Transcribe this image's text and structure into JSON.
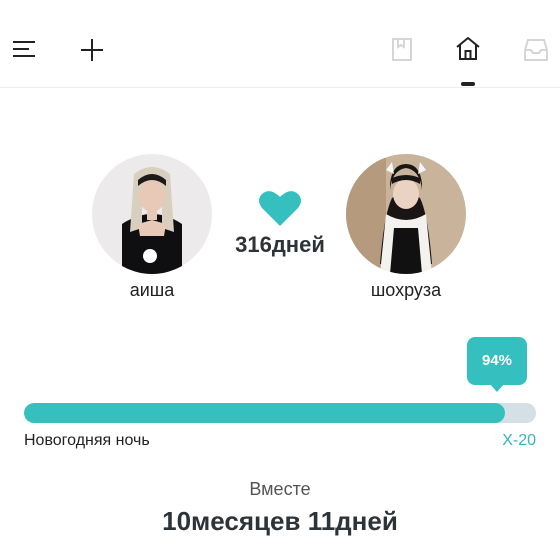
{
  "colors": {
    "accent": "#36bfbf",
    "track": "#d5dfe6",
    "countdown_text": "#36b3bf"
  },
  "toolbar": {
    "left_icons": [
      "menu-icon",
      "add-icon"
    ],
    "right_icons": [
      "bookmark-icon",
      "home-icon",
      "inbox-icon"
    ],
    "active_tab": "home-icon"
  },
  "couple": {
    "left_name": "аиша",
    "right_name": "шохруза",
    "heart_icon": "heart-icon",
    "days_label": "316дней"
  },
  "progress": {
    "percent_label": "94%",
    "fraction": 0.94,
    "event_label": "Новогодняя ночь",
    "countdown_label": "X-20"
  },
  "together": {
    "label": "Вместе",
    "value": "10месяцев 11дней"
  }
}
